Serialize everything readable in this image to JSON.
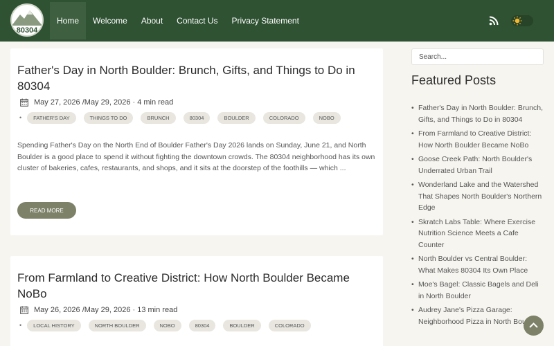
{
  "header": {
    "logo_text": "80304",
    "nav": [
      {
        "label": "Home"
      },
      {
        "label": "Welcome"
      },
      {
        "label": "About"
      },
      {
        "label": "Contact Us"
      },
      {
        "label": "Privacy Statement"
      }
    ],
    "icons": [
      "rss-icon",
      "sun-icon"
    ]
  },
  "posts": [
    {
      "title": "Father's Day in North Boulder: Brunch, Gifts, and Things to Do in 80304",
      "date": "May 27, 2026",
      "updated": "/May 29, 2026",
      "read_time": "· 4 min read",
      "tags": [
        "FATHER'S DAY",
        "THINGS TO DO",
        "BRUNCH",
        "80304",
        "BOULDER",
        "COLORADO",
        "NOBO"
      ],
      "excerpt": "Spending Father's Day on the North End of Boulder Father's Day 2026 lands on Sunday, June 21, and North Boulder is a good place to spend it without fighting the downtown crowds. The 80304 neighborhood has its own cluster of bakeries, cafes, restaurants, and shops, and it sits at the doorstep of the foothills — which ...",
      "read_more": "READ MORE"
    },
    {
      "title": "From Farmland to Creative District: How North Boulder Became NoBo",
      "date": "May 26, 2026",
      "updated": "/May 29, 2026",
      "read_time": "· 13 min read",
      "tags": [
        "LOCAL HISTORY",
        "NORTH BOULDER",
        "NOBO",
        "80304",
        "BOULDER",
        "COLORADO"
      ]
    }
  ],
  "sidebar": {
    "search_placeholder": "Search...",
    "featured_title": "Featured Posts",
    "featured": [
      "Father's Day in North Boulder: Brunch, Gifts, and Things to Do in 80304",
      "From Farmland to Creative District: How North Boulder Became NoBo",
      "Goose Creek Path: North Boulder's Underrated Urban Trail",
      "Wonderland Lake and the Watershed That Shapes North Boulder's Northern Edge",
      "Skratch Labs Table: Where Exercise Nutrition Science Meets a Cafe Counter",
      "North Boulder vs Central Boulder: What Makes 80304 Its Own Place",
      "Moe's Bagel: Classic Bagels and Deli in North Boulder",
      "Audrey Jane's Pizza Garage: Neighborhood Pizza in North Boulder"
    ]
  },
  "colors": {
    "header_bg": "#2f5233",
    "accent": "#7c8167",
    "page_bg": "#f6f5f0"
  }
}
